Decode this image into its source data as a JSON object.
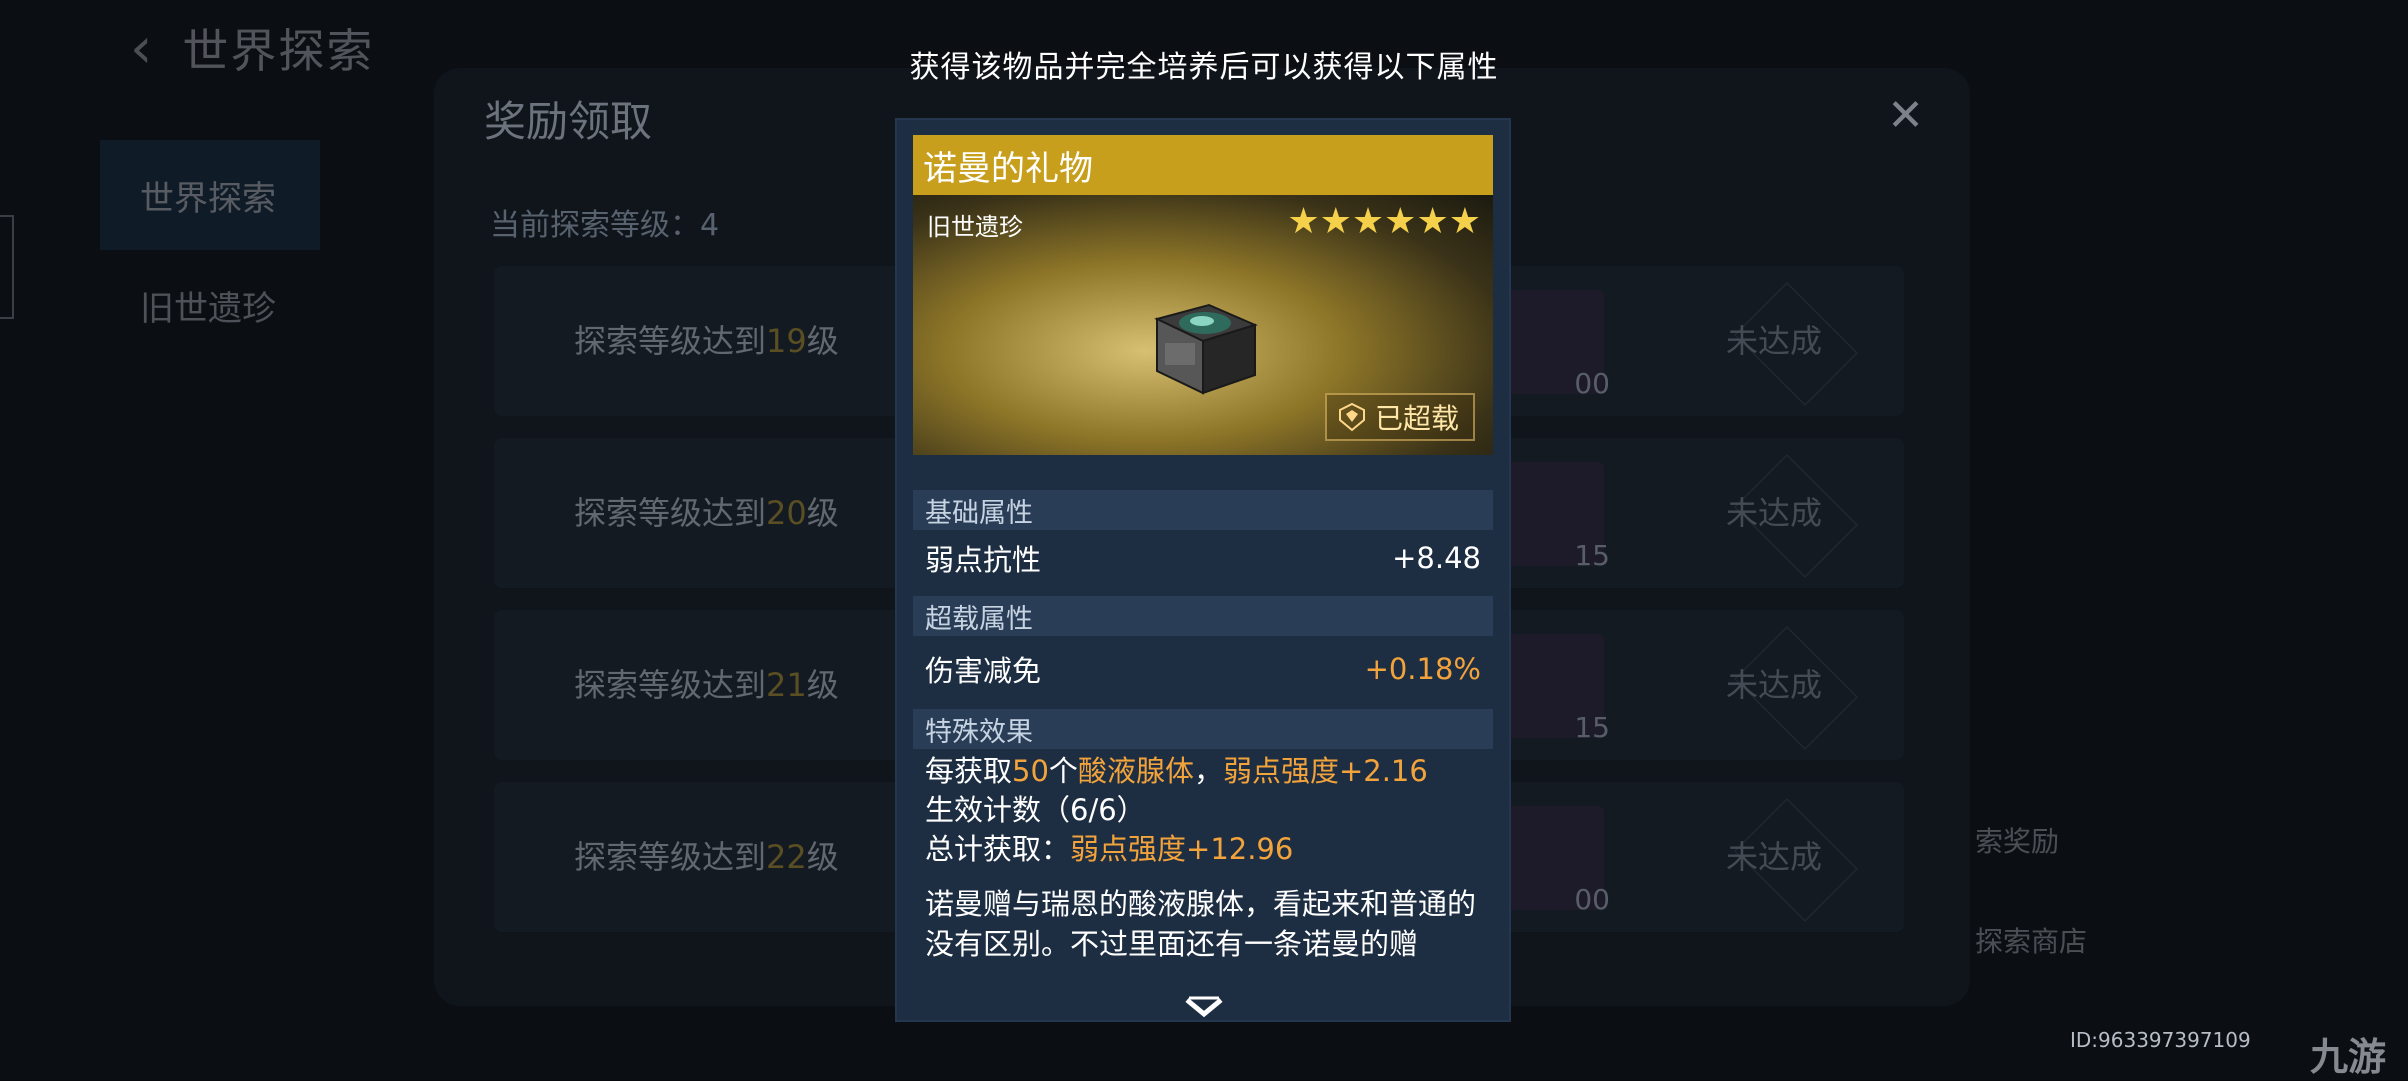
{
  "background": {
    "header_title": "世界探索",
    "sidebar_items": [
      {
        "label": "世界探索",
        "active": true
      },
      {
        "label": "旧世遗珍",
        "active": false
      }
    ],
    "panel_title": "奖励领取",
    "current_level_label": "当前探索等级：4",
    "rows": [
      {
        "cond_prefix": "探索等级达到",
        "cond_num": "19",
        "cond_suffix": "级",
        "reward_count": "00",
        "status": "未达成"
      },
      {
        "cond_prefix": "探索等级达到",
        "cond_num": "20",
        "cond_suffix": "级",
        "reward_count": "15",
        "status": "未达成"
      },
      {
        "cond_prefix": "探索等级达到",
        "cond_num": "21",
        "cond_suffix": "级",
        "reward_count": "15",
        "status": "未达成"
      },
      {
        "cond_prefix": "探索等级达到",
        "cond_num": "22",
        "cond_suffix": "级",
        "reward_count": "00",
        "status": "未达成"
      }
    ],
    "right_labels": [
      "索奖励",
      "探索商店"
    ],
    "user_id": "ID:963397397109",
    "watermark": "九游"
  },
  "modal": {
    "caption": "获得该物品并完全培养后可以获得以下属性",
    "item": {
      "name": "诺曼的礼物",
      "category": "旧世遗珍",
      "stars": "★★★★★★",
      "overload_badge": "已超载",
      "icon": "relic-box-icon"
    },
    "sections": {
      "base_title": "基础属性",
      "base_attr_name": "弱点抗性",
      "base_attr_value": "+8.48",
      "overload_title": "超载属性",
      "overload_attr_name": "伤害减免",
      "overload_attr_value": "+0.18%",
      "special_title": "特殊效果"
    },
    "special": {
      "line1_a": "每获取",
      "line1_b": "50",
      "line1_c": "个",
      "line1_d": "酸液腺体",
      "line1_e": "，",
      "line1_f": "弱点强度+2.16",
      "line2": "生效计数（6/6）",
      "line3_a": "总计获取：",
      "line3_b": "弱点强度+12.96"
    },
    "description": "诺曼赠与瑞恩的酸液腺体，看起来和普通的没有区别。不过里面还有一条诺曼的赠",
    "colors": {
      "title_bar": "#c79f1c",
      "accent_orange": "#f2a33c",
      "star": "#f5d04a"
    }
  }
}
